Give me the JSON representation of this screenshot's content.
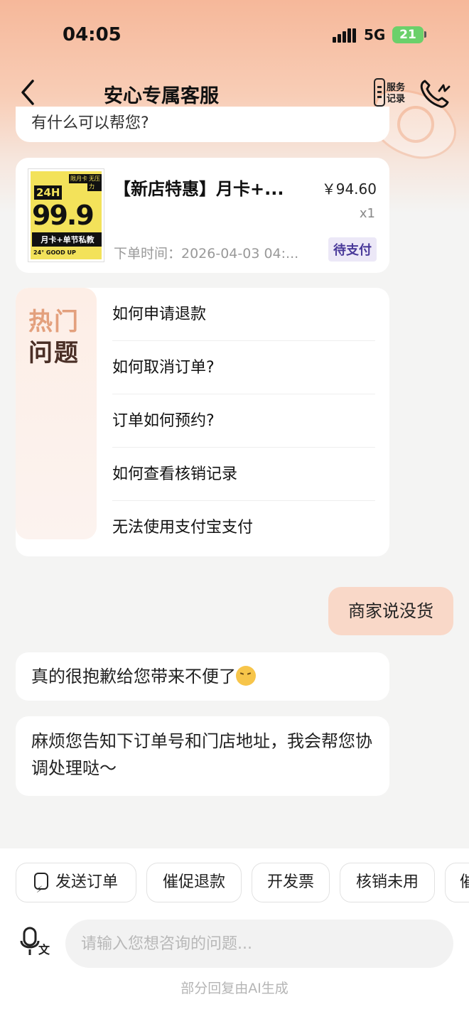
{
  "status_bar": {
    "time": "04:05",
    "network": "5G",
    "battery": "21"
  },
  "header": {
    "title": "安心专属客服",
    "record_label_line1": "服务",
    "record_label_line2": "记录"
  },
  "prev_bubble_text": "有什么可以帮您?",
  "order": {
    "title": "【新店特惠】月卡+...",
    "price": "￥94.60",
    "qty": "x1",
    "time": "下单时间：2026-04-03 04:...",
    "status": "待支付",
    "thumb": {
      "badge": "24H",
      "tag1": "限月卡",
      "tag2": "无压力",
      "big": "99.9",
      "sub": "月卡+单节私教",
      "foot": "24° GOOD UP"
    }
  },
  "faq": {
    "side_line1": "热门",
    "side_line2": "问题",
    "items": [
      "如何申请退款",
      "如何取消订单?",
      "订单如何预约?",
      "如何查看核销记录",
      "无法使用支付宝支付"
    ]
  },
  "messages": {
    "user": "商家说没货",
    "bot1": "真的很抱歉给您带来不便了",
    "bot1_emoji": "pensive-face-emoji",
    "bot2": "麻烦您告知下订单号和门店地址，我会帮您协调处理哒～"
  },
  "chips": [
    "发送订单",
    "催促退款",
    "开发票",
    "核销未用",
    "催"
  ],
  "input": {
    "placeholder": "请输入您想咨询的问题..."
  },
  "footer_note": "部分回复由AI生成",
  "colors": {
    "accent": "#f9d8c8",
    "status_tag_bg": "#ece8f7",
    "status_tag_text": "#4a3a9a",
    "hot_text": "#e3a07d"
  }
}
